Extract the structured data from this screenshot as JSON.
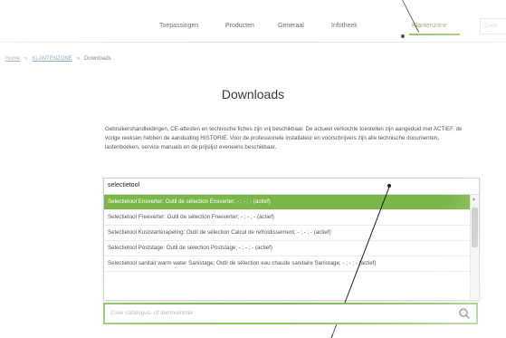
{
  "nav": {
    "items": [
      "Toepassingen",
      "Producten",
      "Generaal",
      "Infotheek",
      "Klantenzone"
    ],
    "active": "Klantenzone",
    "search_placeholder": "Zoek"
  },
  "breadcrumb": {
    "home": "Home",
    "sep1": "»",
    "zone": "KLANTENZONE",
    "sep2": "»",
    "current": "Downloads"
  },
  "page": {
    "title": "Downloads",
    "intro": "Gebruikershandleidingen, CE-attesten en technische fiches zijn vrij beschikbaar. De actueel verkochte toestellen zijn aangeduid met ACTIEF, de vorige reeksen hebben de aanduiding HISTORIE. Voor de professionele installateur en voorschrijvers zijn alle technische documenten, lastenboeken, service manuals en de prijslijst eveneens beschikbaar."
  },
  "dropdown": {
    "query": "selectietool",
    "items": [
      "Selectietool Ensverter: Outil de sélection Ensverter; - ; - ; - (actief)",
      "Selectietool Freeverter: Outil de sélection Freeverter; - ; - ; - (actief)",
      "Selectietool Kuststarterapeling: Outil de sélection Calcul de refroidissement; - ; - ; - (actief)",
      "Selectietool Poststage: Outil de sélection Poststage; - ; - ; - (actief)",
      "Selectietool sanitair warm water Sanistage; Outil de sélection eau chaude sanitaire Sanistage; - ; - ; - (actief)"
    ]
  },
  "search": {
    "placeholder": "Zoek catalogus- of itemnummer"
  },
  "colors": {
    "accent": "#7ab648",
    "text": "#555555"
  }
}
